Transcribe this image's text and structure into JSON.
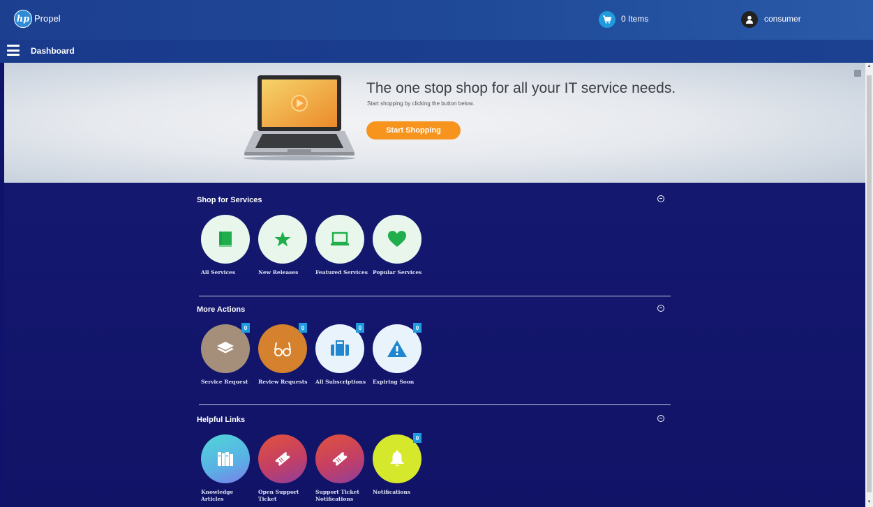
{
  "header": {
    "logo_text": "hp",
    "app_name": "Propel",
    "cart_label": "0 Items",
    "user_name": "consumer"
  },
  "subbar": {
    "title": "Dashboard"
  },
  "banner": {
    "title": "The one stop shop for all your IT service needs.",
    "subtitle": "Start shopping by clicking the button below.",
    "button_label": "Start Shopping"
  },
  "sections": {
    "shop": {
      "title": "Shop for Services",
      "tiles": [
        {
          "label": "All Services",
          "icon": "book-icon",
          "color": "#e8f6ec"
        },
        {
          "label": "New Releases",
          "icon": "star-icon",
          "color": "#e8f6ec"
        },
        {
          "label": "Featured Services",
          "icon": "laptop-icon",
          "color": "#e8f6ec"
        },
        {
          "label": "Popular Services",
          "icon": "heart-icon",
          "color": "#e8f6ec"
        }
      ]
    },
    "actions": {
      "title": "More Actions",
      "tiles": [
        {
          "label": "Service Request",
          "icon": "layers-icon",
          "color": "#a58f7a",
          "count": "0"
        },
        {
          "label": "Review Requests",
          "icon": "glasses-icon",
          "color": "#d5812d",
          "count": "0"
        },
        {
          "label": "All Subscriptions",
          "icon": "briefcase-icon",
          "color": "#e9f3fb",
          "count": "0"
        },
        {
          "label": "Expiring Soon",
          "icon": "warning-icon",
          "color": "#e9f3fb",
          "count": "0"
        }
      ]
    },
    "links": {
      "title": "Helpful Links",
      "tiles": [
        {
          "label_line1": "Knowledge",
          "label_line2": "Articles",
          "icon": "bookshelf-icon"
        },
        {
          "label_line1": "Open Support",
          "label_line2": "Ticket",
          "icon": "ticket-icon"
        },
        {
          "label_line1": "Support Ticket",
          "label_line2": "Notifications",
          "icon": "ticket-icon"
        },
        {
          "label_line1": "Notifications",
          "label_line2": "",
          "icon": "bell-icon",
          "count": "0"
        }
      ]
    }
  },
  "colors": {
    "accent_orange": "#f7941d",
    "badge_blue": "#1f9bde",
    "icon_green": "#1fae4b"
  }
}
